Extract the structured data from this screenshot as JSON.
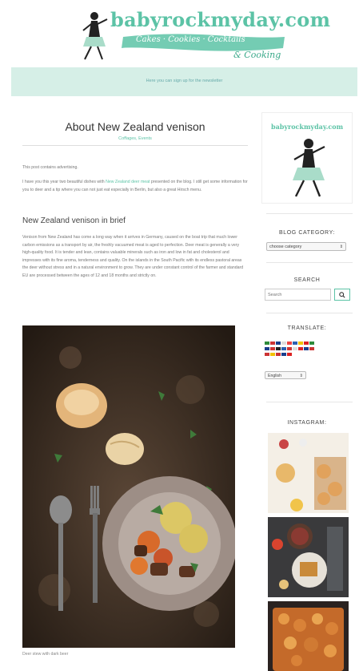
{
  "header": {
    "site_title": "babyrockmyday.com",
    "subtitle_line1": "Cakes · Cookies · Cocktails",
    "subtitle_line2": "& Cooking",
    "newsletter_text": "Here you can sign up for the newsletter"
  },
  "post": {
    "title": "About New Zealand venison",
    "categories": "Coffages, Events",
    "advertising_note": "This post contains advertising.",
    "intro_prefix": "I have you this year two beautiful dishes with ",
    "intro_link": "New Zealand deer meat",
    "intro_suffix": " presented on the blog. I still get some information for you to deer and a tip where you can not just eat especially in Berlin, but also a great Hirsch menu.",
    "section_heading": "New Zealand venison in brief",
    "body": "Venison from New Zealand has come a long way when it arrives in Germany, caused on the boat trip that much lower carbon emissions as a transport by air, the freshly vacuumed meat is aged to perfection. Deer meat is generally a very high-quality food. It is tender and lean, contains valuable minerals such as iron and low in fat and cholesterol and impresses with its fine aroma, tenderness and quality. On the islands in the South Pacific with its endless pastoral areas the deer without stress and in a natural environment to grow. They are under constant control of the farmer and standard EU are processed between the ages of 12 and 18 months and strictly on.",
    "image_caption": "Deer stew with dark beer"
  },
  "sidebar": {
    "logo_text": "babyrockmyday.com",
    "category_heading": "BLOG CATEGORY:",
    "category_select": "choose category",
    "search_heading": "SEARCH",
    "search_placeholder": "Search",
    "translate_heading": "TRANSLATE:",
    "language_select": "English",
    "instagram_heading": "INSTAGRAM:"
  },
  "icons": {
    "search": "search-icon",
    "select_arrow": "chevron-updown-icon"
  },
  "colors": {
    "accent": "#5cc3a6",
    "newsletter_bg": "#d6efe7"
  }
}
